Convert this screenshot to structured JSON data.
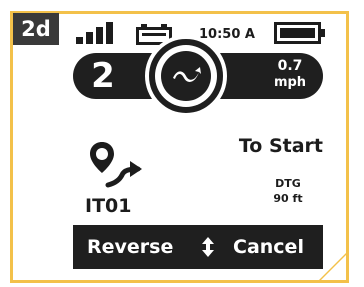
{
  "badge": {
    "label": "2d"
  },
  "status": {
    "time": "10:50 A",
    "signal_bars": 4,
    "device_battery_level": 1.0
  },
  "nav": {
    "mode_number": "2",
    "heading_icon": "heading-arrow-icon",
    "speed_value": "0.7",
    "speed_unit": "mph"
  },
  "waypoint": {
    "icon": "waypoint-route-icon",
    "id": "IT01",
    "direction": "To Start",
    "dtg_label": "DTG",
    "dtg_value": "90 ft"
  },
  "softkeys": {
    "left_label": "Reverse",
    "right_label": "Cancel",
    "separator_icon": "up-down-arrow-icon"
  },
  "colors": {
    "accent": "#f3c14a",
    "bar": "#1f1f1f",
    "text": "#1c1c1c",
    "background": "#ffffff"
  }
}
